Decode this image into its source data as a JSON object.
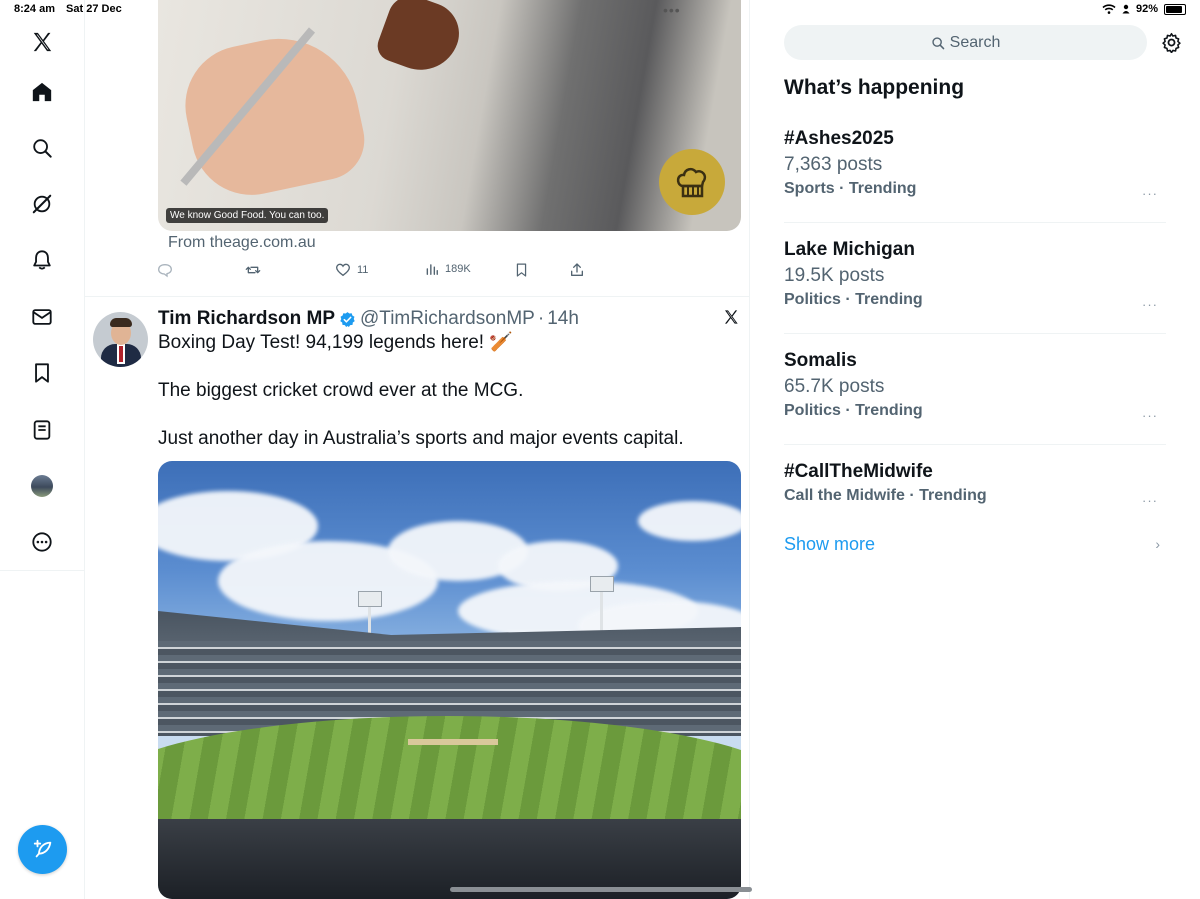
{
  "status_bar": {
    "time": "8:24 am",
    "date": "Sat 27 Dec",
    "battery": "92%"
  },
  "nav": {
    "items": [
      "x-logo",
      "home",
      "explore",
      "grok",
      "notifications",
      "messages",
      "bookmarks",
      "lists",
      "profile",
      "more"
    ],
    "compose": "compose-icon"
  },
  "prev_post": {
    "image_caption": "We know Good Food. You can too.",
    "source": "From theage.com.au",
    "likes": "11",
    "views": "189K"
  },
  "post": {
    "name": "Tim Richardson MP",
    "handle": "@TimRichardsonMP",
    "separator": "·",
    "time": "14h",
    "lines": [
      "Boxing Day Test! 94,199 legends here! 🏏",
      "The biggest cricket crowd ever at the MCG.",
      "Just another day in Australia’s sports and major events capital."
    ]
  },
  "sidebar": {
    "search_placeholder": "Search",
    "heading": "What’s happening",
    "trends": [
      {
        "title": "#Ashes2025",
        "count": "7,363 posts",
        "meta": "Sports · Trending"
      },
      {
        "title": "Lake Michigan",
        "count": "19.5K posts",
        "meta": "Politics · Trending"
      },
      {
        "title": "Somalis",
        "count": "65.7K posts",
        "meta": "Politics · Trending"
      },
      {
        "title": "#CallTheMidwife",
        "count": "",
        "meta": "Call the Midwife · Trending"
      }
    ],
    "show_more": "Show more",
    "more_glyph": "···"
  },
  "colors": {
    "accent": "#1d9bf0",
    "text": "#0f1419",
    "muted": "#536471"
  }
}
